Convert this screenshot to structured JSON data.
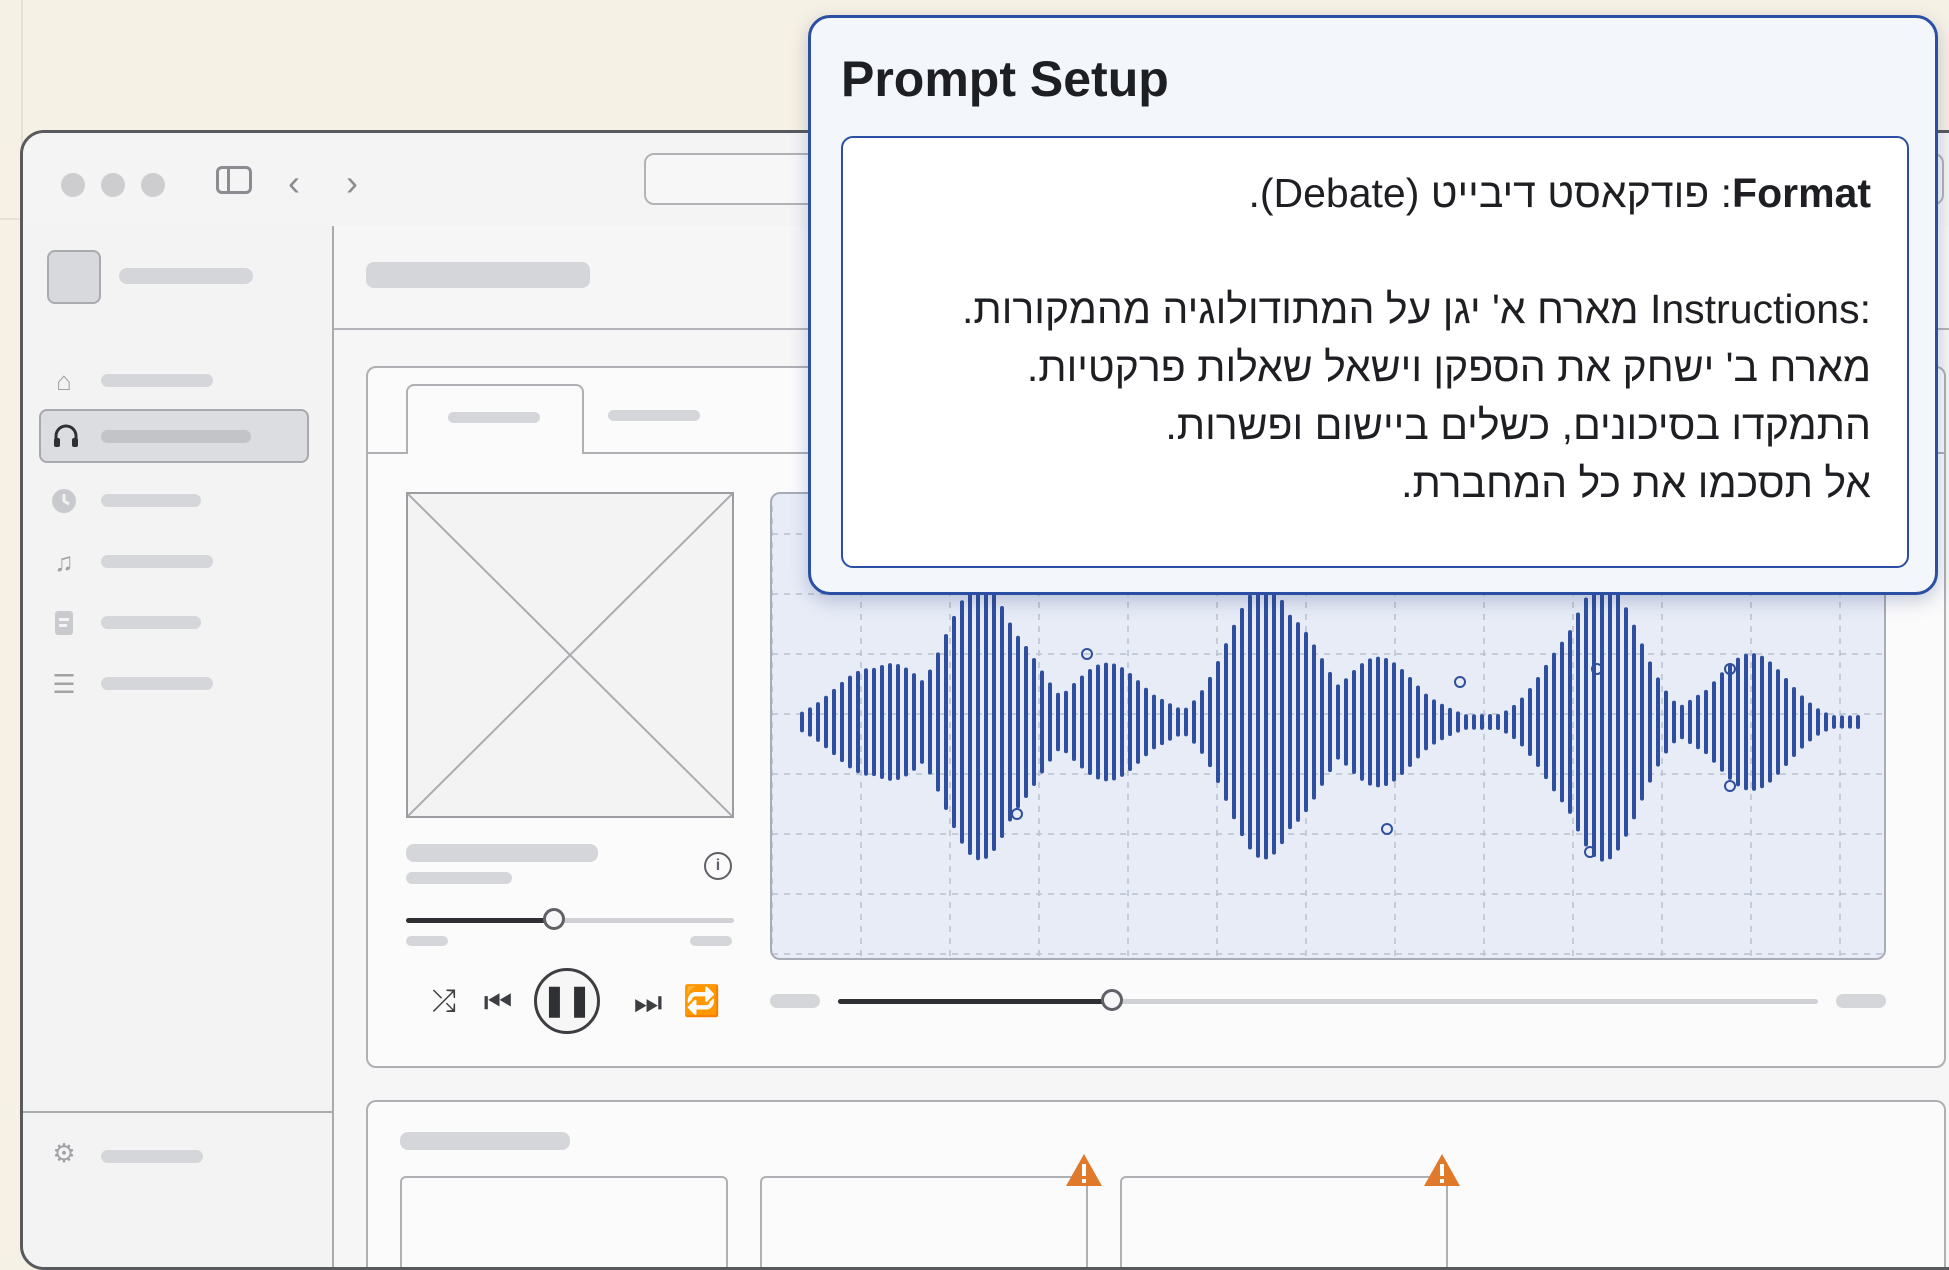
{
  "popup": {
    "title": "Prompt Setup",
    "format_label": "Format",
    "format_value": ": פודקאסט דיבייט (Debate).",
    "instructions_label": "Instructions:",
    "instructions_line1": " מארח א' יגן על המתודולוגיה מהמקורות.",
    "instructions_line2": "מארח ב' ישחק את הספקן וישאל שאלות פרקטיות.",
    "instructions_line3": "התמקדו בסיכונים, כשלים ביישום ופשרות.",
    "instructions_line4": "אל תסכמו את כל המחברת."
  },
  "player": {
    "volume_level": 0.45,
    "timeline_progress": 0.28
  },
  "colors": {
    "popup_border": "#2b4fa3",
    "waveform": "#2f4f9e",
    "warning": "#e07a2a"
  },
  "icons": {
    "sidebar": [
      "home-icon",
      "headphones-icon",
      "clock-icon",
      "music-icon",
      "document-icon",
      "list-icon"
    ],
    "settings": "gear-icon"
  }
}
